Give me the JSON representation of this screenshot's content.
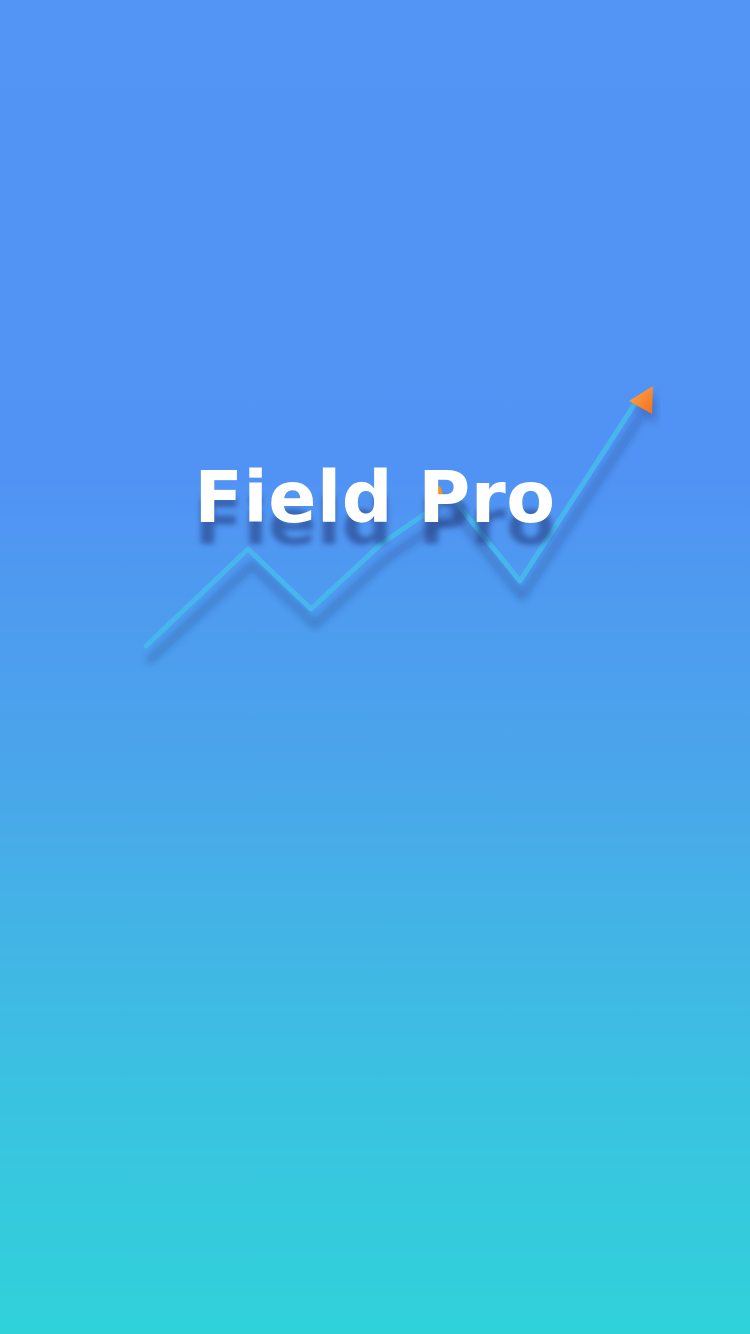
{
  "app": {
    "title": "Field Pro"
  },
  "logo": {
    "graphic_icon": "trending-up-arrow-icon",
    "line_color": "#47B6EC",
    "arrow_color": "#FF8A33"
  },
  "colors": {
    "background_top": "#5295F4",
    "background_bottom": "#30D2DA",
    "title_text": "#FFFFFF"
  }
}
